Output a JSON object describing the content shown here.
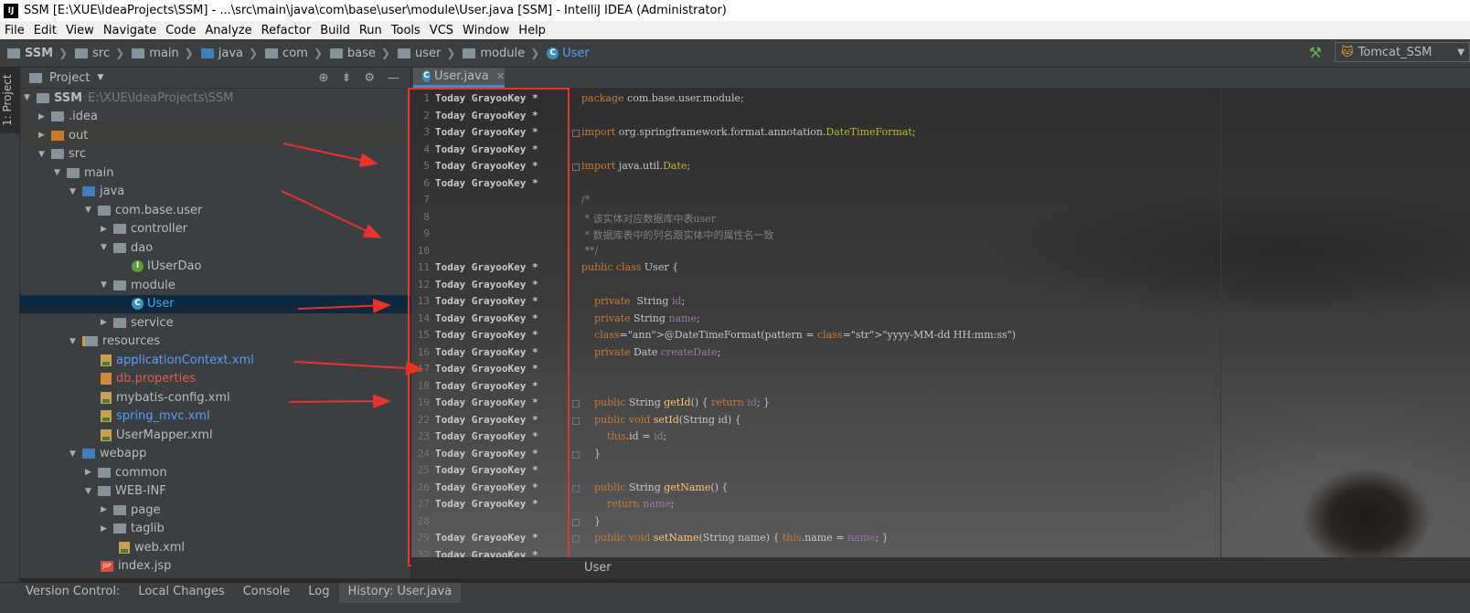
{
  "window": {
    "app_icon": "IJ",
    "title": "SSM [E:\\XUE\\IdeaProjects\\SSM] - ...\\src\\main\\java\\com\\base\\user\\module\\User.java [SSM] - IntelliJ IDEA (Administrator)"
  },
  "menu": [
    "File",
    "Edit",
    "View",
    "Navigate",
    "Code",
    "Analyze",
    "Refactor",
    "Build",
    "Run",
    "Tools",
    "VCS",
    "Window",
    "Help"
  ],
  "breadcrumbs": [
    "SSM",
    "src",
    "main",
    "java",
    "com",
    "base",
    "user",
    "module",
    "User"
  ],
  "run_config": {
    "label": "Tomcat_SSM"
  },
  "left_strip": {
    "project_tab": "1: Project"
  },
  "project_panel": {
    "title": "Project",
    "tree": [
      {
        "label": "SSM",
        "extra": "E:\\XUE\\IdeaProjects\\SSM"
      },
      {
        "label": ".idea"
      },
      {
        "label": "out"
      },
      {
        "label": "src"
      },
      {
        "label": "main"
      },
      {
        "label": "java"
      },
      {
        "label": "com.base.user"
      },
      {
        "label": "controller"
      },
      {
        "label": "dao"
      },
      {
        "label": "IUserDao"
      },
      {
        "label": "module"
      },
      {
        "label": "User"
      },
      {
        "label": "service"
      },
      {
        "label": "resources"
      },
      {
        "label": "applicationContext.xml"
      },
      {
        "label": "db.properties"
      },
      {
        "label": "mybatis-config.xml"
      },
      {
        "label": "spring_mvc.xml"
      },
      {
        "label": "UserMapper.xml"
      },
      {
        "label": "webapp"
      },
      {
        "label": "common"
      },
      {
        "label": "WEB-INF"
      },
      {
        "label": "page"
      },
      {
        "label": "taglib"
      },
      {
        "label": "web.xml"
      },
      {
        "label": "index.jsp"
      }
    ]
  },
  "editor": {
    "tab": "User.java",
    "annotation_text": "Today GrayooKey *",
    "lines": [
      {
        "n": "1",
        "blame": true,
        "code": "package com.base.user.module;"
      },
      {
        "n": "2",
        "blame": true,
        "code": ""
      },
      {
        "n": "3",
        "blame": true,
        "code": "import org.springframework.format.annotation.DateTimeFormat;"
      },
      {
        "n": "4",
        "blame": true,
        "code": ""
      },
      {
        "n": "5",
        "blame": true,
        "code": "import java.util.Date;"
      },
      {
        "n": "6",
        "blame": true,
        "code": ""
      },
      {
        "n": "7",
        "blame": false,
        "code": "/*"
      },
      {
        "n": "8",
        "blame": false,
        "code": " * 该实体对应数据库中表user"
      },
      {
        "n": "9",
        "blame": false,
        "code": " * 数据库表中的列名跟实体中的属性名一致"
      },
      {
        "n": "10",
        "blame": false,
        "code": " **/"
      },
      {
        "n": "11",
        "blame": true,
        "code": "public class User {"
      },
      {
        "n": "12",
        "blame": true,
        "code": ""
      },
      {
        "n": "13",
        "blame": true,
        "code": "    private  String id;"
      },
      {
        "n": "14",
        "blame": true,
        "code": "    private String name;"
      },
      {
        "n": "15",
        "blame": true,
        "code": "    @DateTimeFormat(pattern = \"yyyy-MM-dd HH:mm:ss\")"
      },
      {
        "n": "16",
        "blame": true,
        "code": "    private Date createDate;"
      },
      {
        "n": "17",
        "blame": true,
        "code": ""
      },
      {
        "n": "18",
        "blame": true,
        "code": ""
      },
      {
        "n": "19",
        "blame": true,
        "code": "    public String getId() { return id; }"
      },
      {
        "n": "22",
        "blame": true,
        "code": "    public void setId(String id) {"
      },
      {
        "n": "23",
        "blame": true,
        "code": "        this.id = id;"
      },
      {
        "n": "24",
        "blame": true,
        "code": "    }"
      },
      {
        "n": "25",
        "blame": true,
        "code": ""
      },
      {
        "n": "26",
        "blame": true,
        "code": "    public String getName() {"
      },
      {
        "n": "27",
        "blame": true,
        "code": "        return name;"
      },
      {
        "n": "28",
        "blame": false,
        "code": "    }"
      },
      {
        "n": "29",
        "blame": true,
        "code": "    public void setName(String name) { this.name = name; }"
      },
      {
        "n": "32",
        "blame": true,
        "code": ""
      }
    ]
  },
  "editor_breadcrumb": "User",
  "bottom_tabs": [
    "Version Control:",
    "Local Changes",
    "Console",
    "Log",
    "History: User.java"
  ],
  "colors": {
    "accent": "#4a88c7",
    "annotation_box": "#e8322c",
    "selection": "#0d293e"
  }
}
